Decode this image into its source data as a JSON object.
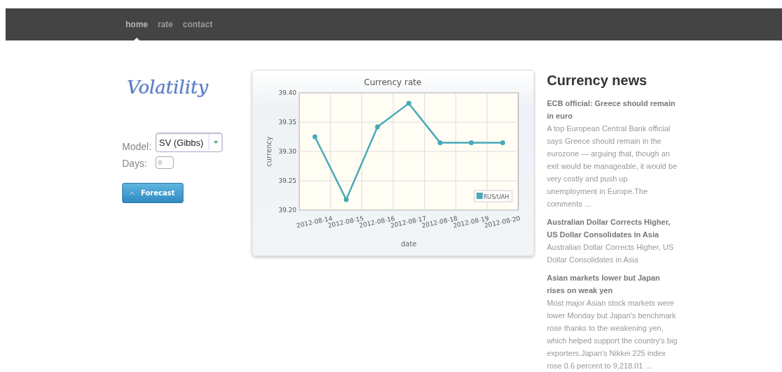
{
  "nav": [
    {
      "label": "home",
      "selected": true
    },
    {
      "label": "rate",
      "selected": false
    },
    {
      "label": "contact",
      "selected": false
    }
  ],
  "logo": "Volatility",
  "form": {
    "model_label": "Model:",
    "model_value": "SV (Gibbs)",
    "days_label": "Days:",
    "days_value": "0",
    "button": "Forecast"
  },
  "chart_data": {
    "type": "line",
    "title": "Currency rate",
    "xlabel": "date",
    "ylabel": "currency",
    "categories": [
      "2012-08-14",
      "2012-08-15",
      "2012-08-16",
      "2012-08-17",
      "2012-08-18",
      "2012-08-19",
      "2012-08-20"
    ],
    "series": [
      {
        "name": "RUS/UAH",
        "color": "#4aa8b8",
        "marker": "circle",
        "values": [
          39.325,
          39.218,
          39.342,
          39.382,
          39.315,
          39.315,
          39.315
        ]
      }
    ],
    "ylim": [
      39.2,
      39.4
    ],
    "grid": true,
    "yticks": [
      {
        "value": 39.2,
        "label": "39.20"
      },
      {
        "value": 39.25,
        "label": "39.25"
      },
      {
        "value": 39.3,
        "label": "39.30"
      },
      {
        "value": 39.35,
        "label": "39.35"
      },
      {
        "value": 39.4,
        "label": "39.40"
      }
    ]
  },
  "news": {
    "title": "Currency news",
    "items": [
      {
        "headline": "ECB official: Greece should remain in euro",
        "summary": "A top European Central Bank official says Greece should remain in the eurozone — arguing that, though an exit would be manageable, it would be very costly and push up unemployment in Europe.The comments ..."
      },
      {
        "headline": "Australian Dollar Corrects Higher, US Dollar Consolidates in Asia",
        "summary": "Australian Dollar Corrects Higher, US Dollar Consolidates in Asia"
      },
      {
        "headline": "Asian markets lower but Japan rises on weak yen",
        "summary": "Most major Asian stock markets were lower Monday but Japan's benchmark rose thanks to the weakening yen, which helped support the country's big exporters.Japan's Nikkei 225 index rose 0.6 percent to 9,218.01 ..."
      }
    ]
  }
}
